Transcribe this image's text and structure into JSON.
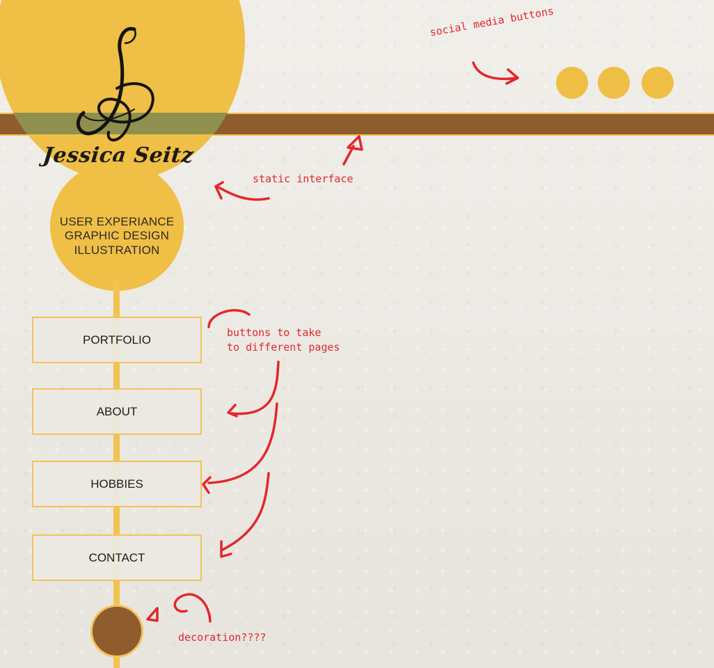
{
  "brand": {
    "name": "Jessica Seitz",
    "monogram": "JS"
  },
  "tagline": [
    "USER EXPERIANCE",
    "GRAPHIC DESIGN",
    "ILLUSTRATION"
  ],
  "nav": [
    {
      "label": "PORTFOLIO"
    },
    {
      "label": "ABOUT"
    },
    {
      "label": "HOBBIES"
    },
    {
      "label": "CONTACT"
    }
  ],
  "social": {
    "count": 3
  },
  "annotations": {
    "social": "social media buttons",
    "static": "static interface",
    "buttons": "buttons to take\nto different pages",
    "decoration": "decoration????"
  },
  "colors": {
    "accent_yellow": "#efbf46",
    "brown": "#8e5c2d",
    "olive": "#8f904d",
    "background": "#ece9e2",
    "annotation_red": "#e4262c"
  }
}
